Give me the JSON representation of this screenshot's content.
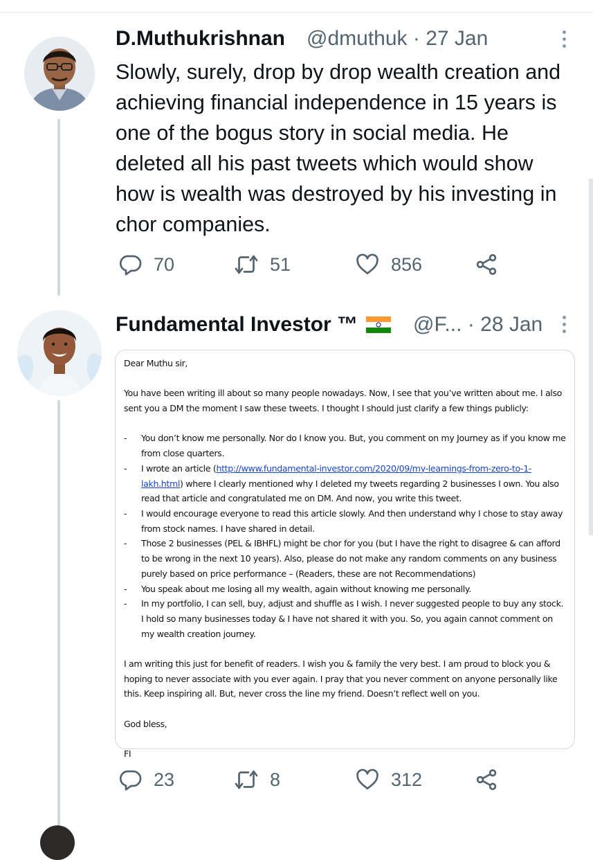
{
  "tweet1": {
    "display_name": "D.Muthukrishnan",
    "handle": "@dmuthuk",
    "separator": "·",
    "date": "27 Jan",
    "text": "Slowly, surely, drop by drop wealth creation and achieving financial independence in 15 years is one of the bogus story in social media. He deleted all his past tweets which would show how is wealth was destroyed by his investing in chor companies.",
    "replies": "70",
    "retweets": "51",
    "likes": "856"
  },
  "tweet2": {
    "display_name": "Fundamental Investor ™",
    "handle": "@F...",
    "separator": "·",
    "date": "28 Jan",
    "replies": "23",
    "retweets": "8",
    "likes": "312",
    "letter": {
      "greeting": "Dear Muthu sir,",
      "intro": "You have been writing ill about so many people nowadays. Now, I see that you’ve written about me. I also sent you a DM the moment I saw these tweets. I thought I should just clarify a few things publicly:",
      "bullet_dash": "-",
      "bullets": [
        "You don’t know me personally. Nor do I know you. But, you comment on my Journey as if you know me from close quarters.",
        "I wrote an article (",
        "I would encourage everyone to read this article slowly. And then understand why I chose to stay away from stock names. I have shared in detail.",
        "Those 2 businesses (PEL & IBHFL) might be chor for you (but I have the right to disagree & can afford to be wrong in the next 10 years). Also, please do not make any random comments on any business purely based on price performance – (Readers, these are not Recommendations)",
        "You speak about me losing all my wealth, again without knowing me personally.",
        "In my portfolio, I can sell, buy, adjust and shuffle as I wish. I never suggested people to buy any stock. I hold so many businesses today & I have not shared it with you. So, you again cannot comment on my wealth creation journey."
      ],
      "article_link": "http://www.fundamental-investor.com/2020/09/my-learnings-from-zero-to-1-lakh.html",
      "article_suffix": ") where I clearly mentioned why I deleted my tweets regarding 2 businesses I own. You also read that article and congratulated me on DM. And now, you write this tweet.",
      "closing": "I am writing this just for benefit of readers. I wish you & family the very best. I am proud to block you & hoping to never associate with you ever again. I pray that you never comment on anyone personally like this. Keep inspiring all. But, never cross the line my friend. Doesn’t reflect well on you.",
      "sign_off": "God bless,",
      "signature": "FI"
    }
  },
  "icons": [
    "reply-icon",
    "retweet-icon",
    "like-icon",
    "share-icon",
    "more-icon",
    "india-flag-icon"
  ],
  "colors": {
    "text": "#0f1419",
    "secondary": "#536471",
    "thread_line": "#cfd9de",
    "link": "#1a46c8",
    "flag_saffron": "#ff9933",
    "flag_green": "#138808"
  }
}
